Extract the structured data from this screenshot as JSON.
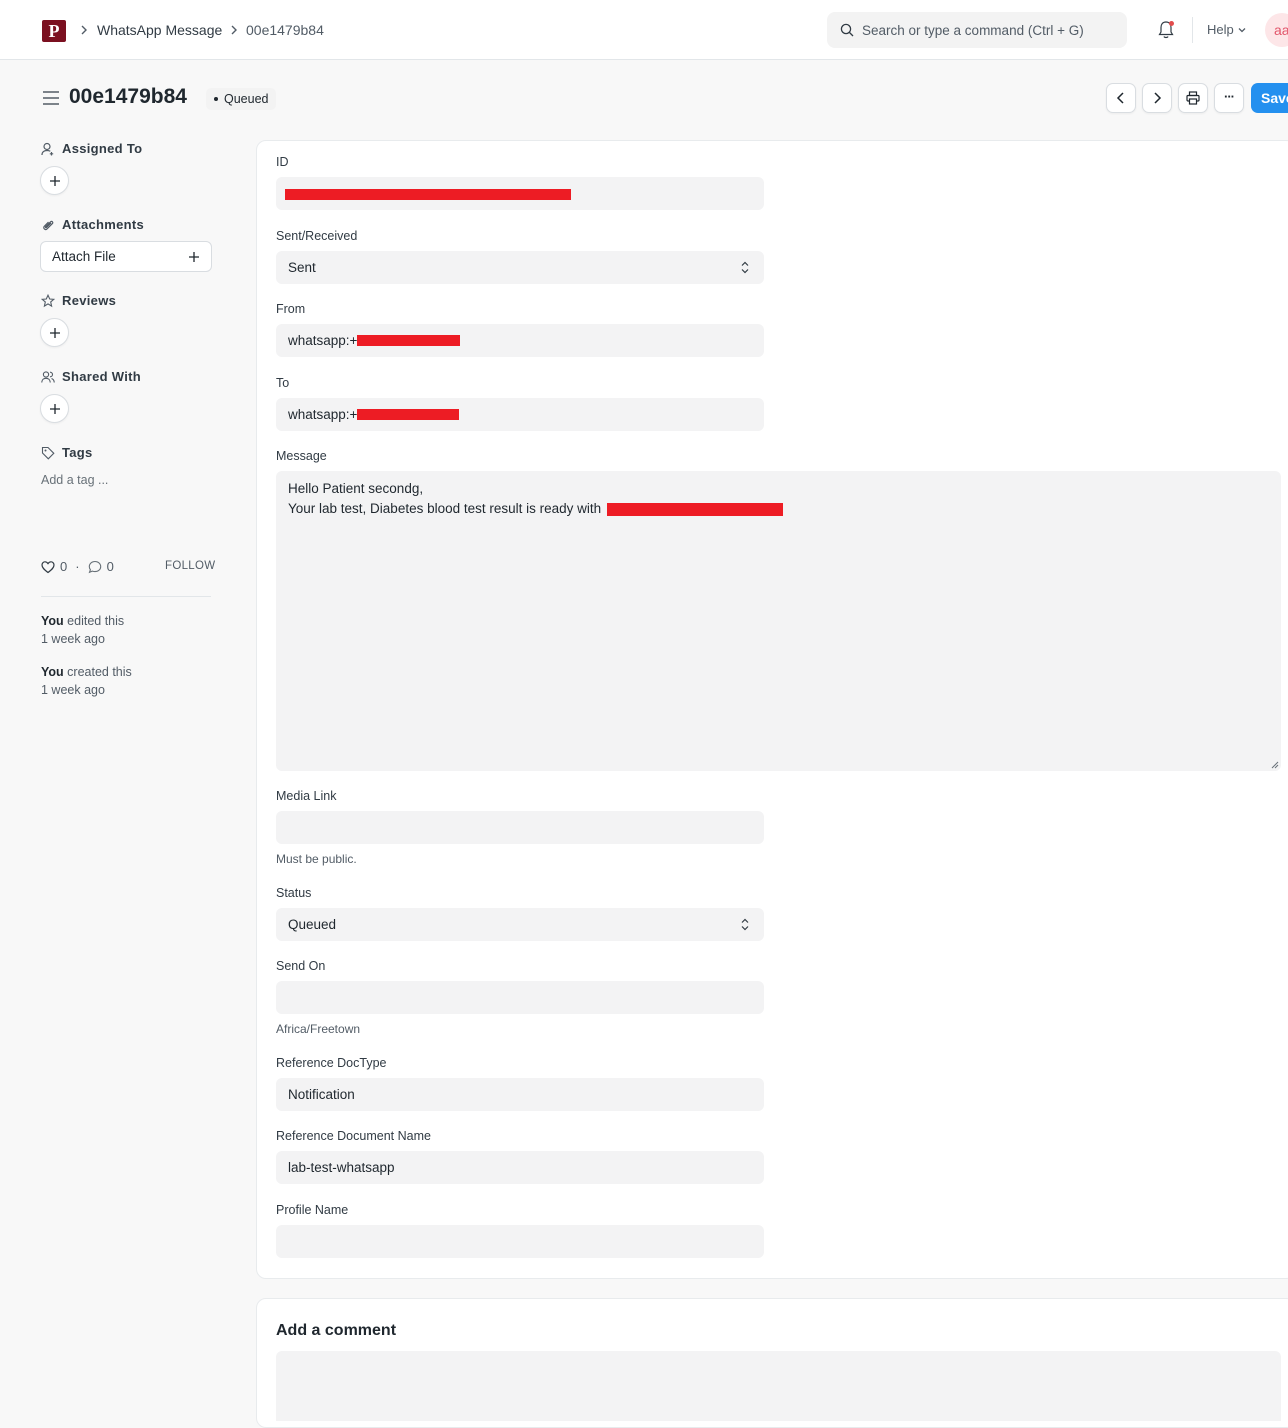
{
  "navbar": {
    "logo_text": "P",
    "breadcrumbs": [
      "WhatsApp Message",
      "00e1479b84"
    ],
    "search_placeholder": "Search or type a command (Ctrl + G)",
    "help_label": "Help",
    "avatar_initials": "aa"
  },
  "header": {
    "title": "00e1479b84",
    "status": "Queued",
    "save_label": "Save",
    "more_label": "···"
  },
  "sidebar": {
    "assigned_to": "Assigned To",
    "attachments": "Attachments",
    "attach_file": "Attach File",
    "reviews": "Reviews",
    "shared_with": "Shared With",
    "tags": "Tags",
    "add_tag": "Add a tag ...",
    "likes_count": "0",
    "comments_count": "0",
    "separator": "·",
    "follow": "FOLLOW",
    "activity": [
      {
        "who": "You",
        "action": " edited this",
        "when": "1 week ago"
      },
      {
        "who": "You",
        "action": " created this",
        "when": "1 week ago"
      }
    ]
  },
  "form": {
    "id_label": "ID",
    "sent_received_label": "Sent/Received",
    "sent_received_value": "Sent",
    "from_label": "From",
    "from_prefix": "whatsapp:+",
    "to_label": "To",
    "to_prefix": "whatsapp:+",
    "message_label": "Message",
    "message_line1": "Hello Patient secondg,",
    "message_line2": "Your lab test, Diabetes blood test result is ready with",
    "media_link_label": "Media Link",
    "media_link_help": "Must be public.",
    "status_label": "Status",
    "status_value": "Queued",
    "send_on_label": "Send On",
    "send_on_help": "Africa/Freetown",
    "ref_doctype_label": "Reference DocType",
    "ref_doctype_value": "Notification",
    "ref_docname_label": "Reference Document Name",
    "ref_docname_value": "lab-test-whatsapp",
    "profile_name_label": "Profile Name"
  },
  "comments": {
    "title": "Add a comment"
  },
  "colors": {
    "primary": "#2490ef",
    "redaction": "#ed1c24",
    "logo": "#7b1020"
  }
}
